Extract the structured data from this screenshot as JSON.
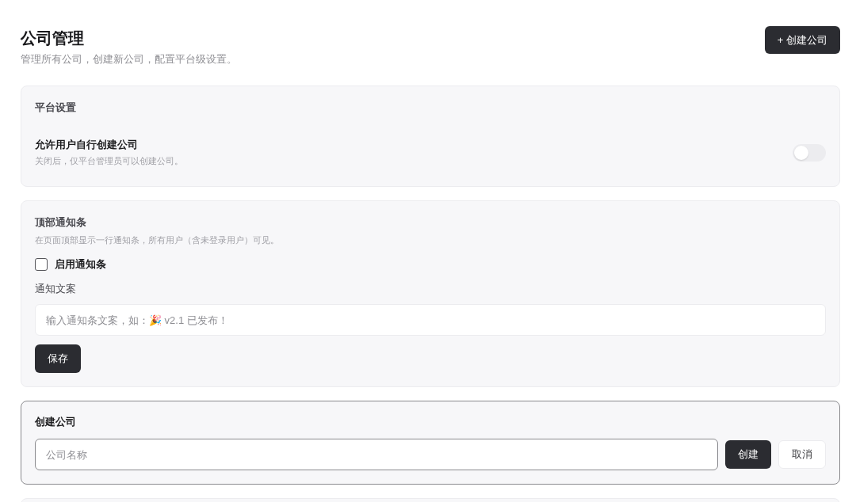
{
  "header": {
    "title": "公司管理",
    "subtitle": "管理所有公司，创建新公司，配置平台级设置。",
    "create_button": "+ 创建公司"
  },
  "platform_settings": {
    "heading": "平台设置",
    "settings": [
      {
        "label": "允许用户自行创建公司",
        "description": "关闭后，仅平台管理员可以创建公司。",
        "on": false
      }
    ]
  },
  "notice_bar": {
    "heading": "顶部通知条",
    "description": "在页面顶部显示一行通知条，所有用户（含未登录用户）可见。",
    "enable": {
      "label": "启用通知条",
      "checked": false
    },
    "text_label": "通知文案",
    "text_field": {
      "placeholder": "输入通知条文案，如：🎉 v2.1 已发布！"
    },
    "save_button": "保存"
  },
  "create_company": {
    "heading": "创建公司",
    "name_field": {
      "placeholder": "公司名称",
      "focused": true
    },
    "buttons": [
      {
        "label": "创建",
        "kind": "primary"
      },
      {
        "label": "取消",
        "kind": "secondary"
      }
    ]
  }
}
